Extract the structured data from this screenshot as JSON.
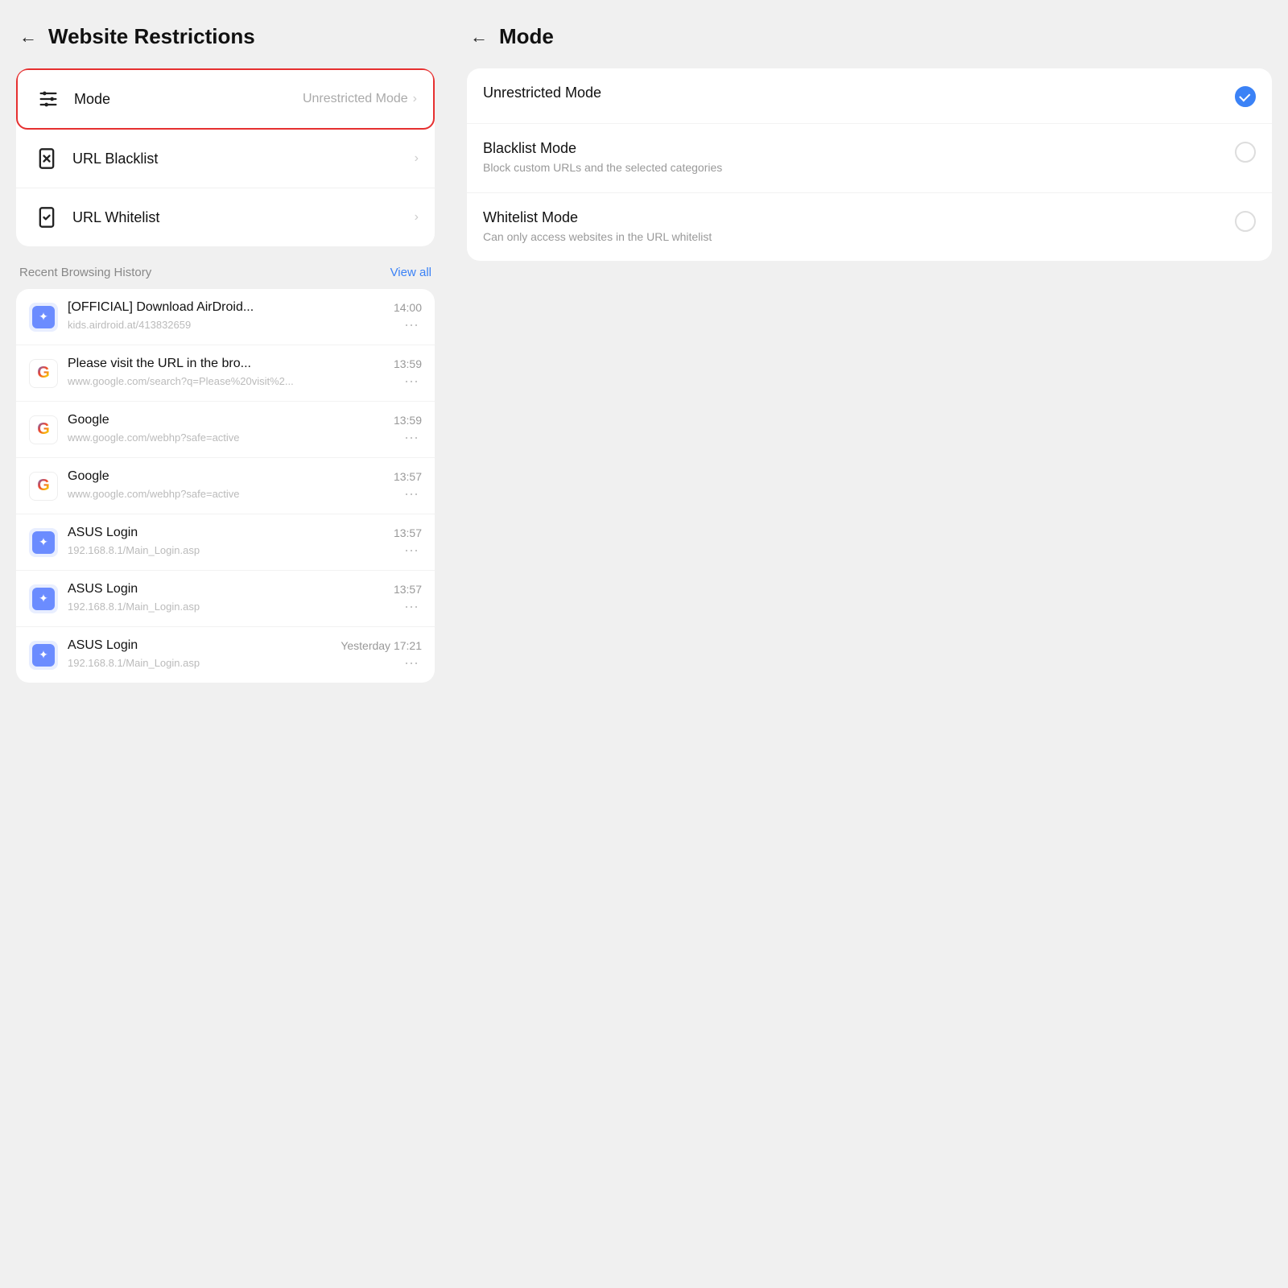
{
  "left": {
    "header": {
      "back_label": "←",
      "title": "Website Restrictions"
    },
    "settings": {
      "items": [
        {
          "id": "mode",
          "label": "Mode",
          "value": "Unrestricted Mode",
          "highlighted": true,
          "icon": "sliders"
        },
        {
          "id": "url-blacklist",
          "label": "URL Blacklist",
          "value": "",
          "highlighted": false,
          "icon": "blacklist"
        },
        {
          "id": "url-whitelist",
          "label": "URL Whitelist",
          "value": "",
          "highlighted": false,
          "icon": "whitelist"
        }
      ]
    },
    "history": {
      "section_label": "Recent Browsing History",
      "view_all_label": "View all",
      "items": [
        {
          "title": "[OFFICIAL] Download AirDroid...",
          "url": "kids.airdroid.at/413832659",
          "time": "14:00",
          "favicon_type": "airdroid"
        },
        {
          "title": "Please visit the URL in the bro...",
          "url": "www.google.com/search?q=Please%20visit%2...",
          "time": "13:59",
          "favicon_type": "google"
        },
        {
          "title": "Google",
          "url": "www.google.com/webhp?safe=active",
          "time": "13:59",
          "favicon_type": "google"
        },
        {
          "title": "Google",
          "url": "www.google.com/webhp?safe=active",
          "time": "13:57",
          "favicon_type": "google"
        },
        {
          "title": "ASUS Login",
          "url": "192.168.8.1/Main_Login.asp",
          "time": "13:57",
          "favicon_type": "airdroid"
        },
        {
          "title": "ASUS Login",
          "url": "192.168.8.1/Main_Login.asp",
          "time": "13:57",
          "favicon_type": "airdroid"
        },
        {
          "title": "ASUS Login",
          "url": "192.168.8.1/Main_Login.asp",
          "time": "Yesterday 17:21",
          "favicon_type": "airdroid"
        }
      ]
    }
  },
  "right": {
    "header": {
      "back_label": "←",
      "title": "Mode"
    },
    "modes": [
      {
        "id": "unrestricted",
        "title": "Unrestricted Mode",
        "desc": "",
        "selected": true
      },
      {
        "id": "blacklist",
        "title": "Blacklist Mode",
        "desc": "Block custom URLs and the selected categories",
        "selected": false
      },
      {
        "id": "whitelist",
        "title": "Whitelist Mode",
        "desc": "Can only access websites in the URL whitelist",
        "selected": false
      }
    ]
  }
}
